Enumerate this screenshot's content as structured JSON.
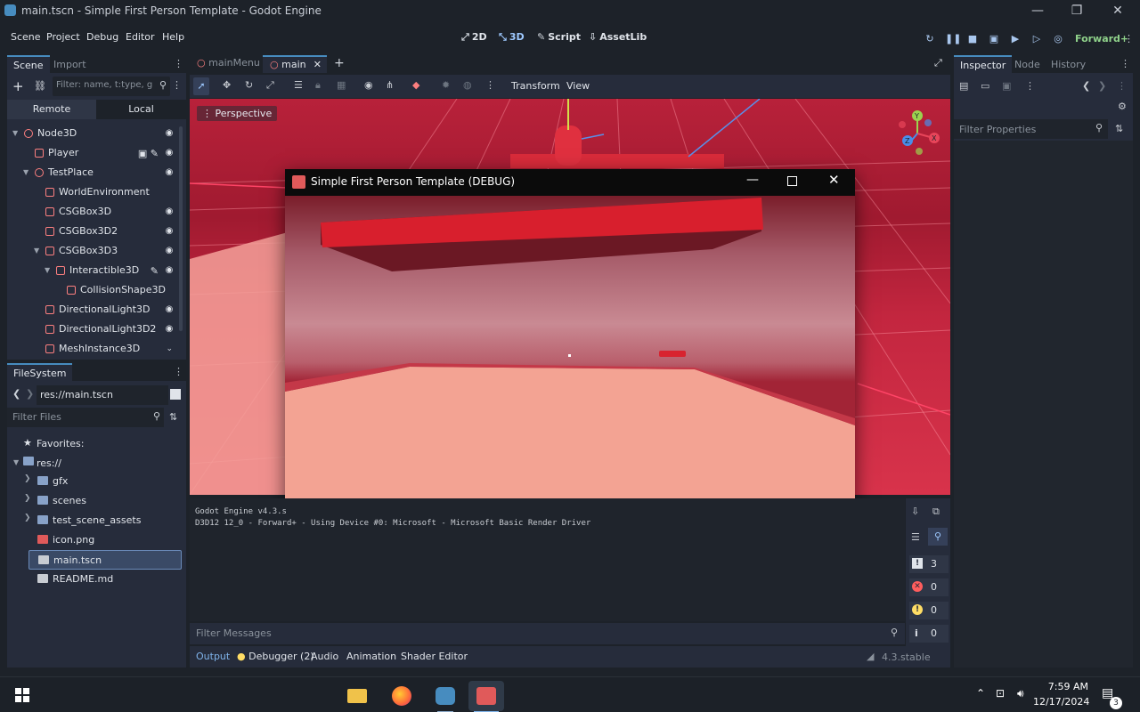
{
  "window": {
    "title": "main.tscn - Simple First Person Template - Godot Engine",
    "minimize": "—",
    "maximize": "❐",
    "close": "✕"
  },
  "menu": [
    "Scene",
    "Project",
    "Debug",
    "Editor",
    "Help"
  ],
  "workspaces": [
    {
      "label": "2D",
      "icon": "2d-icon"
    },
    {
      "label": "3D",
      "icon": "3d-icon",
      "active": true
    },
    {
      "label": "Script",
      "icon": "script-icon"
    },
    {
      "label": "AssetLib",
      "icon": "assetlib-icon"
    }
  ],
  "renderer": "Forward+",
  "scene_dock": {
    "tabs": [
      "Scene",
      "Import"
    ],
    "filter_placeholder": "Filter: name, t:type, g:group",
    "remote_label": "Remote",
    "local_label": "Local",
    "nodes": [
      {
        "label": "Node3D",
        "indent": 0,
        "visible": true,
        "icon": "node3d-icon",
        "color": "#fc7f7f"
      },
      {
        "label": "Player",
        "indent": 1,
        "visible": true,
        "icon": "player-scene-icon",
        "color": "#fc7f7f"
      },
      {
        "label": "TestPlace",
        "indent": 1,
        "visible": true,
        "icon": "node3d-icon",
        "color": "#fc7f7f"
      },
      {
        "label": "WorldEnvironment",
        "indent": 2,
        "visible": false,
        "icon": "world-environment-icon",
        "color": "#fc7f7f"
      },
      {
        "label": "CSGBox3D",
        "indent": 2,
        "visible": true,
        "icon": "csgbox-icon",
        "color": "#fc7f7f"
      },
      {
        "label": "CSGBox3D2",
        "indent": 2,
        "visible": true,
        "icon": "csgbox-icon",
        "color": "#fc7f7f"
      },
      {
        "label": "CSGBox3D3",
        "indent": 2,
        "visible": true,
        "icon": "csgbox-icon",
        "color": "#fc7f7f"
      },
      {
        "label": "Interactible3D",
        "indent": 3,
        "visible": true,
        "icon": "area3d-icon",
        "color": "#fc7f7f"
      },
      {
        "label": "CollisionShape3D",
        "indent": 4,
        "visible": false,
        "icon": "collision-shape-icon",
        "color": "#fc7f7f"
      },
      {
        "label": "DirectionalLight3D",
        "indent": 2,
        "visible": true,
        "icon": "directional-light-icon",
        "color": "#fc7f7f"
      },
      {
        "label": "DirectionalLight3D2",
        "indent": 2,
        "visible": true,
        "icon": "directional-light-icon",
        "color": "#fc7f7f"
      },
      {
        "label": "MeshInstance3D",
        "indent": 2,
        "visible": false,
        "icon": "mesh-instance-icon",
        "color": "#fc7f7f"
      }
    ]
  },
  "filesystem": {
    "tab": "FileSystem",
    "path": "res://main.tscn",
    "filter_placeholder": "Filter Files",
    "favorites": "Favorites:",
    "root": "res://",
    "items": [
      {
        "label": "gfx",
        "type": "folder"
      },
      {
        "label": "scenes",
        "type": "folder"
      },
      {
        "label": "test_scene_assets",
        "type": "folder"
      },
      {
        "label": "icon.png",
        "type": "image"
      },
      {
        "label": "main.tscn",
        "type": "scene",
        "selected": true
      },
      {
        "label": "README.md",
        "type": "file"
      }
    ]
  },
  "doc_tabs": [
    {
      "label": "mainMenu",
      "active": false
    },
    {
      "label": "main",
      "active": true
    }
  ],
  "viewport_toolbar": {
    "transform": "Transform",
    "view": "View",
    "perspective": "Perspective"
  },
  "debug_window": {
    "title": "Simple First Person Template (DEBUG)"
  },
  "output": {
    "lines": [
      "Godot Engine v4.3.s",
      "D3D12 12_0 - Forward+ - Using Device #0: Microsoft - Microsoft Basic Render Driver"
    ],
    "filter_placeholder": "Filter Messages",
    "counts": {
      "messages": "3",
      "errors": "0",
      "warnings": "0",
      "info": "0"
    }
  },
  "bottom_tabs": [
    "Output",
    "Debugger (2)",
    "Audio",
    "Animation",
    "Shader Editor"
  ],
  "version": "4.3.stable",
  "inspector": {
    "tabs": [
      "Inspector",
      "Node",
      "History"
    ],
    "filter_placeholder": "Filter Properties"
  },
  "taskbar": {
    "time": "7:59 AM",
    "date": "12/17/2024",
    "notifications": "3"
  },
  "colors": {
    "accent": "#478cbf",
    "node_red": "#fc7f7f",
    "renderer_green": "#8fd18a",
    "viewport_red": "#b8213a"
  }
}
